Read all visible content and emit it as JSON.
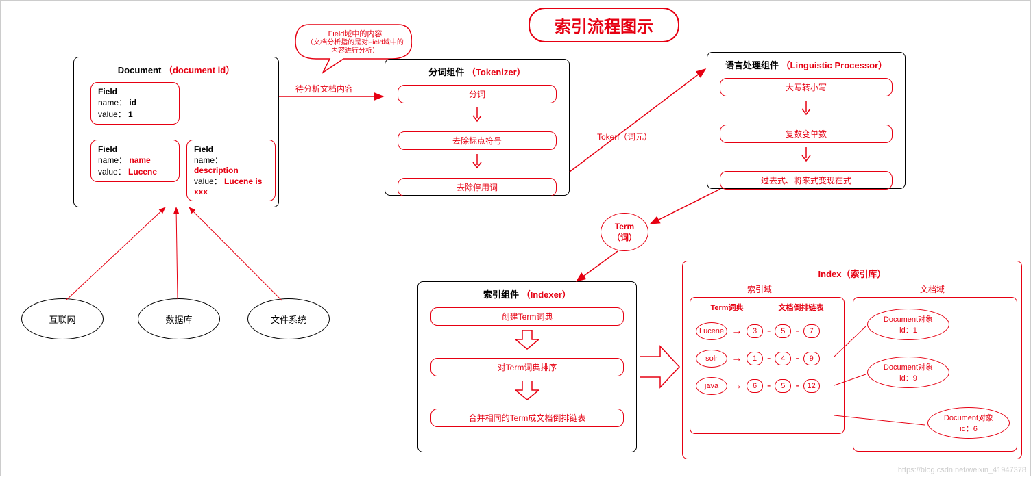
{
  "title": "索引流程图示",
  "bubble": {
    "line1": "Field域中的内容",
    "line2": "（文档分析指的是对Field域中的内容进行分析）"
  },
  "arrow_label": "待分析文档内容",
  "token_label": "Token（词元）",
  "term_label1": "Term",
  "term_label2": "（词）",
  "document": {
    "title": "Document",
    "title_red": "（document id）",
    "field1": {
      "h": "Field",
      "l1a": "name：",
      "l1b": "id",
      "l2a": "value：",
      "l2b": "1"
    },
    "field2": {
      "h": "Field",
      "l1a": "name：",
      "l1b": "name",
      "l2a": "value：",
      "l2b": "Lucene"
    },
    "field3": {
      "h": "Field",
      "l1a": "name：",
      "l1b": "description",
      "l2a": "value：",
      "l2b": "Lucene is xxx"
    }
  },
  "tokenizer": {
    "title": "分词组件",
    "title_red": "（Tokenizer）",
    "s1": "分词",
    "s2": "去除标点符号",
    "s3": "去除停用词"
  },
  "linguistic": {
    "title": "语言处理组件",
    "title_red": "（Linguistic Processor）",
    "s1": "大写转小写",
    "s2": "复数变单数",
    "s3": "过去式、将来式变现在式"
  },
  "indexer": {
    "title": "索引组件",
    "title_red": "（Indexer）",
    "s1": "创建Term词典",
    "s2": "对Term词典排序",
    "s3": "合并相同的Term成文档倒排链表"
  },
  "index": {
    "title": "Index（索引库）",
    "col1": "索引域",
    "col2": "文档域",
    "dict_title": "Term词典",
    "list_title": "文档倒排链表",
    "terms": [
      "Lucene",
      "solr",
      "java"
    ],
    "rows": [
      [
        "3",
        "5",
        "7"
      ],
      [
        "1",
        "4",
        "9"
      ],
      [
        "6",
        "5",
        "12"
      ]
    ],
    "docs": [
      {
        "l1": "Document对象",
        "l2": "id：1"
      },
      {
        "l1": "Document对象",
        "l2": "id：9"
      },
      {
        "l1": "Document对象",
        "l2": "id：6"
      }
    ]
  },
  "sources": {
    "s1": "互联网",
    "s2": "数据库",
    "s3": "文件系统"
  },
  "watermark": "https://blog.csdn.net/weixin_41947378"
}
